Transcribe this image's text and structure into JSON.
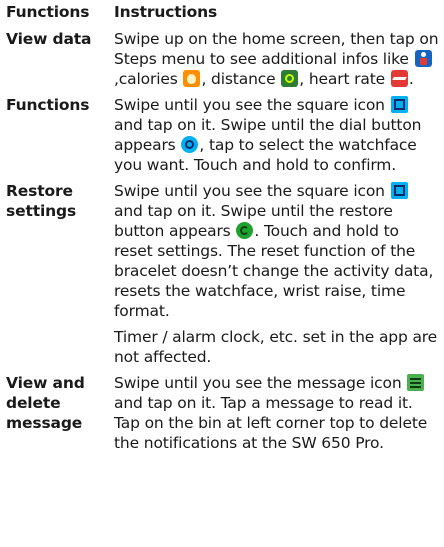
{
  "header": {
    "functions": "Functions",
    "instructions": "Instructions"
  },
  "rows": [
    {
      "function": "View data",
      "parts": [
        "Swipe up on the home screen, then tap on Steps menu to see additional infos like ",
        ",calories ",
        ", distance ",
        ", heart rate ",
        "."
      ],
      "icons": [
        "steps-icon",
        "calories-icon",
        "distance-icon",
        "heart-rate-icon"
      ]
    },
    {
      "function": "Functions",
      "parts": [
        "Swipe until you see the square icon ",
        " and tap on it. Swipe until  the dial button appears ",
        ", tap to select the watchface you want. Touch and hold to confirm."
      ],
      "icons": [
        "square-icon",
        "dial-icon"
      ]
    },
    {
      "function_line1": "Restore",
      "function_line2": "settings",
      "parts": [
        "Swipe until you see the square icon ",
        " and tap on it. Swipe until the restore button appears ",
        ". Touch and hold to reset settings. The reset function of the bracelet doesn’t change the activity data, resets the watchface, wrist raise, time format."
      ],
      "note": "Timer / alarm clock, etc. set in the app are not affected.",
      "icons": [
        "square-icon",
        "restore-icon"
      ]
    },
    {
      "function_line1": "View and",
      "function_line2": "delete",
      "function_line3": "message",
      "parts": [
        "Swipe until you see the message icon ",
        " and tap on it. Tap a message to read it. Tap on the bin at left corner top to delete the notifications at the SW 650 Pro."
      ],
      "icons": [
        "message-icon"
      ]
    }
  ]
}
